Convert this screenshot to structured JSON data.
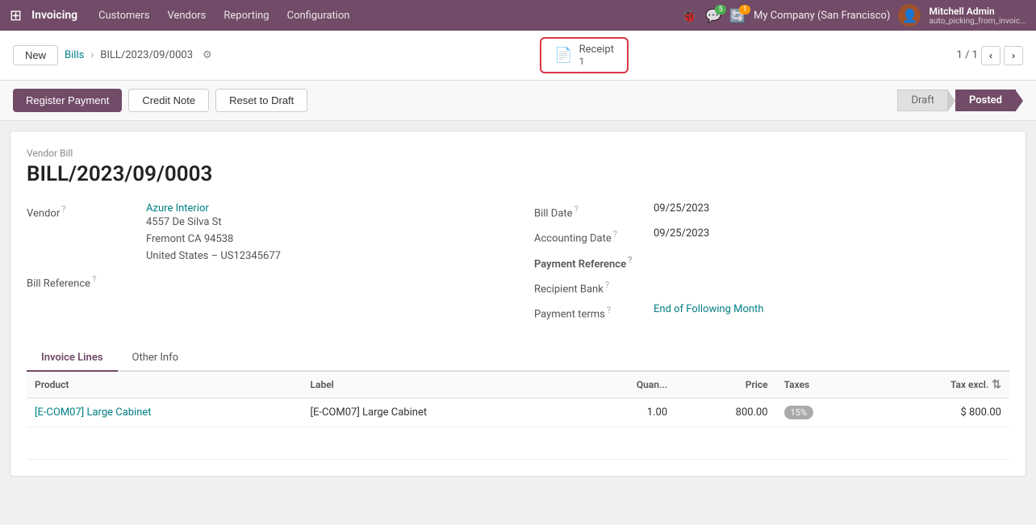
{
  "topnav": {
    "apps_icon": "⊞",
    "brand": "Invoicing",
    "menu_items": [
      "Customers",
      "Vendors",
      "Reporting",
      "Configuration"
    ],
    "bug_icon": "🐞",
    "chat_icon": "💬",
    "chat_badge": "5",
    "update_icon": "🔄",
    "update_badge": "1",
    "company": "My Company (San Francisco)",
    "username": "Mitchell Admin",
    "user_subtitle": "auto_picking_from_invoic...",
    "avatar_icon": "👤"
  },
  "breadcrumb": {
    "new_label": "New",
    "parent": "Bills",
    "current": "BILL/2023/09/0003",
    "gear_icon": "⚙"
  },
  "smart_button": {
    "icon": "📄",
    "label": "Receipt",
    "count": "1"
  },
  "pagination": {
    "current": "1",
    "total": "1",
    "prev_icon": "‹",
    "next_icon": "›"
  },
  "actions": {
    "register_payment": "Register Payment",
    "credit_note": "Credit Note",
    "reset_to_draft": "Reset to Draft"
  },
  "status": {
    "draft_label": "Draft",
    "posted_label": "Posted",
    "active": "Posted"
  },
  "form": {
    "vendor_label": "Vendor Bill",
    "bill_number": "BILL/2023/09/0003",
    "vendor_field": "Vendor",
    "vendor_name": "Azure Interior",
    "vendor_address_1": "4557 De Silva St",
    "vendor_address_2": "Fremont CA 94538",
    "vendor_address_3": "United States – US12345677",
    "bill_reference_label": "Bill Reference",
    "bill_date_label": "Bill Date",
    "bill_date_value": "09/25/2023",
    "accounting_date_label": "Accounting Date",
    "accounting_date_value": "09/25/2023",
    "payment_reference_label": "Payment Reference",
    "payment_reference_value": "",
    "recipient_bank_label": "Recipient Bank",
    "recipient_bank_value": "",
    "payment_terms_label": "Payment terms",
    "payment_terms_value": "End of Following Month"
  },
  "tabs": [
    {
      "id": "invoice-lines",
      "label": "Invoice Lines",
      "active": true
    },
    {
      "id": "other-info",
      "label": "Other Info",
      "active": false
    }
  ],
  "table": {
    "columns": [
      "Product",
      "Label",
      "Quan...",
      "Price",
      "Taxes",
      "Tax excl."
    ],
    "rows": [
      {
        "product_link": "[E-COM07] Large Cabinet",
        "label": "[E-COM07] Large Cabinet",
        "quantity": "1.00",
        "price": "800.00",
        "tax": "15%",
        "tax_excl": "$ 800.00"
      }
    ]
  }
}
